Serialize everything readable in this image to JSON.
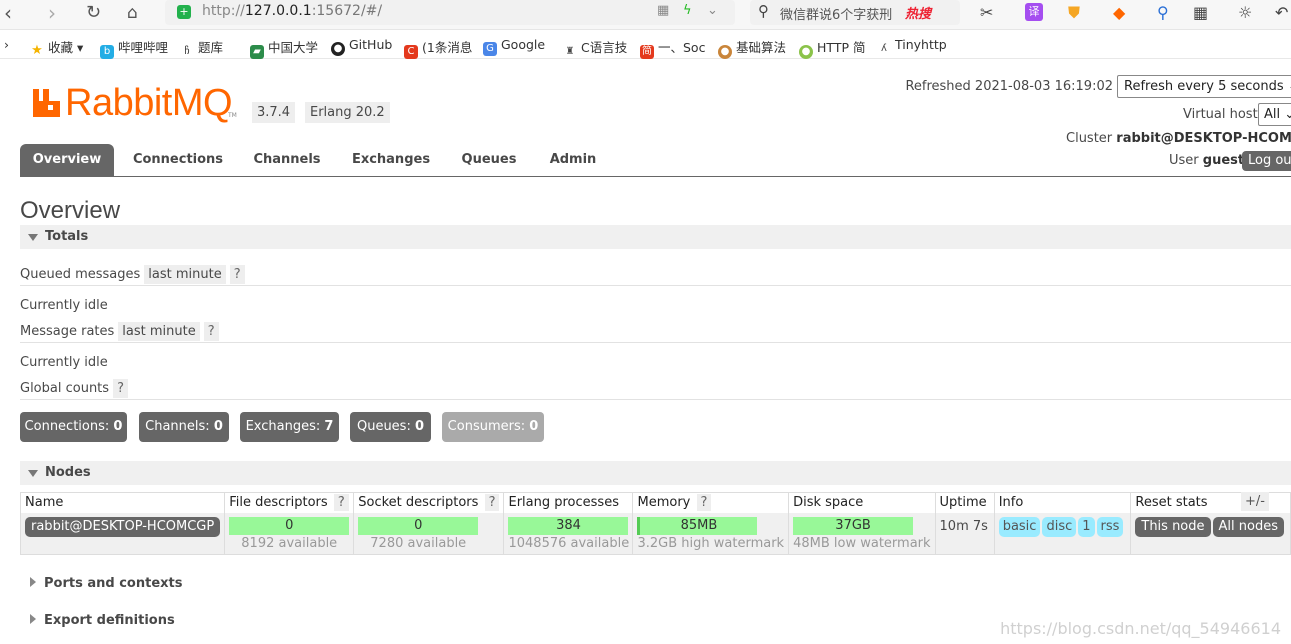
{
  "browser": {
    "url_host": "127.0.0.1",
    "url_rest": ":15672/#/",
    "search_text": "微信群说6个字获刑",
    "hot_label": "热搜",
    "bookmarks": [
      "收藏",
      "哔哩哔哩",
      "题库",
      "中国大学",
      "GitHub",
      "(1条消息",
      "Google",
      "C语言技",
      "一、Soc",
      "基础算法",
      "HTTP 简",
      "Tinyhttp"
    ]
  },
  "header": {
    "logo_text": "RabbitMQ",
    "logo_tm": "TM",
    "version": "3.7.4",
    "erlang": "Erlang 20.2",
    "refreshed": "Refreshed 2021-08-03 16:19:02",
    "refresh_option": "Refresh every 5 seconds",
    "vhost_label": "Virtual host",
    "vhost_value": "All",
    "cluster_label": "Cluster",
    "cluster_value": "rabbit@DESKTOP-HCOMCGP",
    "user_label": "User",
    "user_value": "guest",
    "logout": "Log out"
  },
  "tabs": [
    "Overview",
    "Connections",
    "Channels",
    "Exchanges",
    "Queues",
    "Admin"
  ],
  "page_title": "Overview",
  "totals": {
    "title": "Totals",
    "queued_label": "Queued messages",
    "queued_chip": "last minute",
    "help": "?",
    "queued_idle": "Currently idle",
    "rates_label": "Message rates",
    "rates_chip": "last minute",
    "rates_idle": "Currently idle",
    "global_label": "Global counts"
  },
  "counts": [
    {
      "label": "Connections:",
      "value": "0"
    },
    {
      "label": "Channels:",
      "value": "0"
    },
    {
      "label": "Exchanges:",
      "value": "7"
    },
    {
      "label": "Queues:",
      "value": "0"
    },
    {
      "label": "Consumers:",
      "value": "0"
    }
  ],
  "nodes": {
    "title": "Nodes",
    "columns": [
      "Name",
      "File descriptors",
      "Socket descriptors",
      "Erlang processes",
      "Memory",
      "Disk space",
      "Uptime",
      "Info",
      "Reset stats"
    ],
    "plusminus": "+/-",
    "row": {
      "name": "rabbit@DESKTOP-HCOMCGP",
      "fd_value": "0",
      "fd_sub": "8192 available",
      "sd_value": "0",
      "sd_sub": "7280 available",
      "ep_value": "384",
      "ep_sub": "1048576 available",
      "mem_value": "85MB",
      "mem_sub": "3.2GB high watermark",
      "disk_value": "37GB",
      "disk_sub": "48MB low watermark",
      "uptime": "10m 7s",
      "info": [
        "basic",
        "disc",
        "1",
        "rss"
      ],
      "reset": [
        "This node",
        "All nodes"
      ]
    }
  },
  "ports_title": "Ports and contexts",
  "export_title": "Export definitions",
  "watermark": "https://blog.csdn.net/qq_54946614",
  "colors": {
    "brand": "#ff6600",
    "tab_active": "#666666",
    "bar_green": "#98f898",
    "info_blue": "#99ebff"
  }
}
